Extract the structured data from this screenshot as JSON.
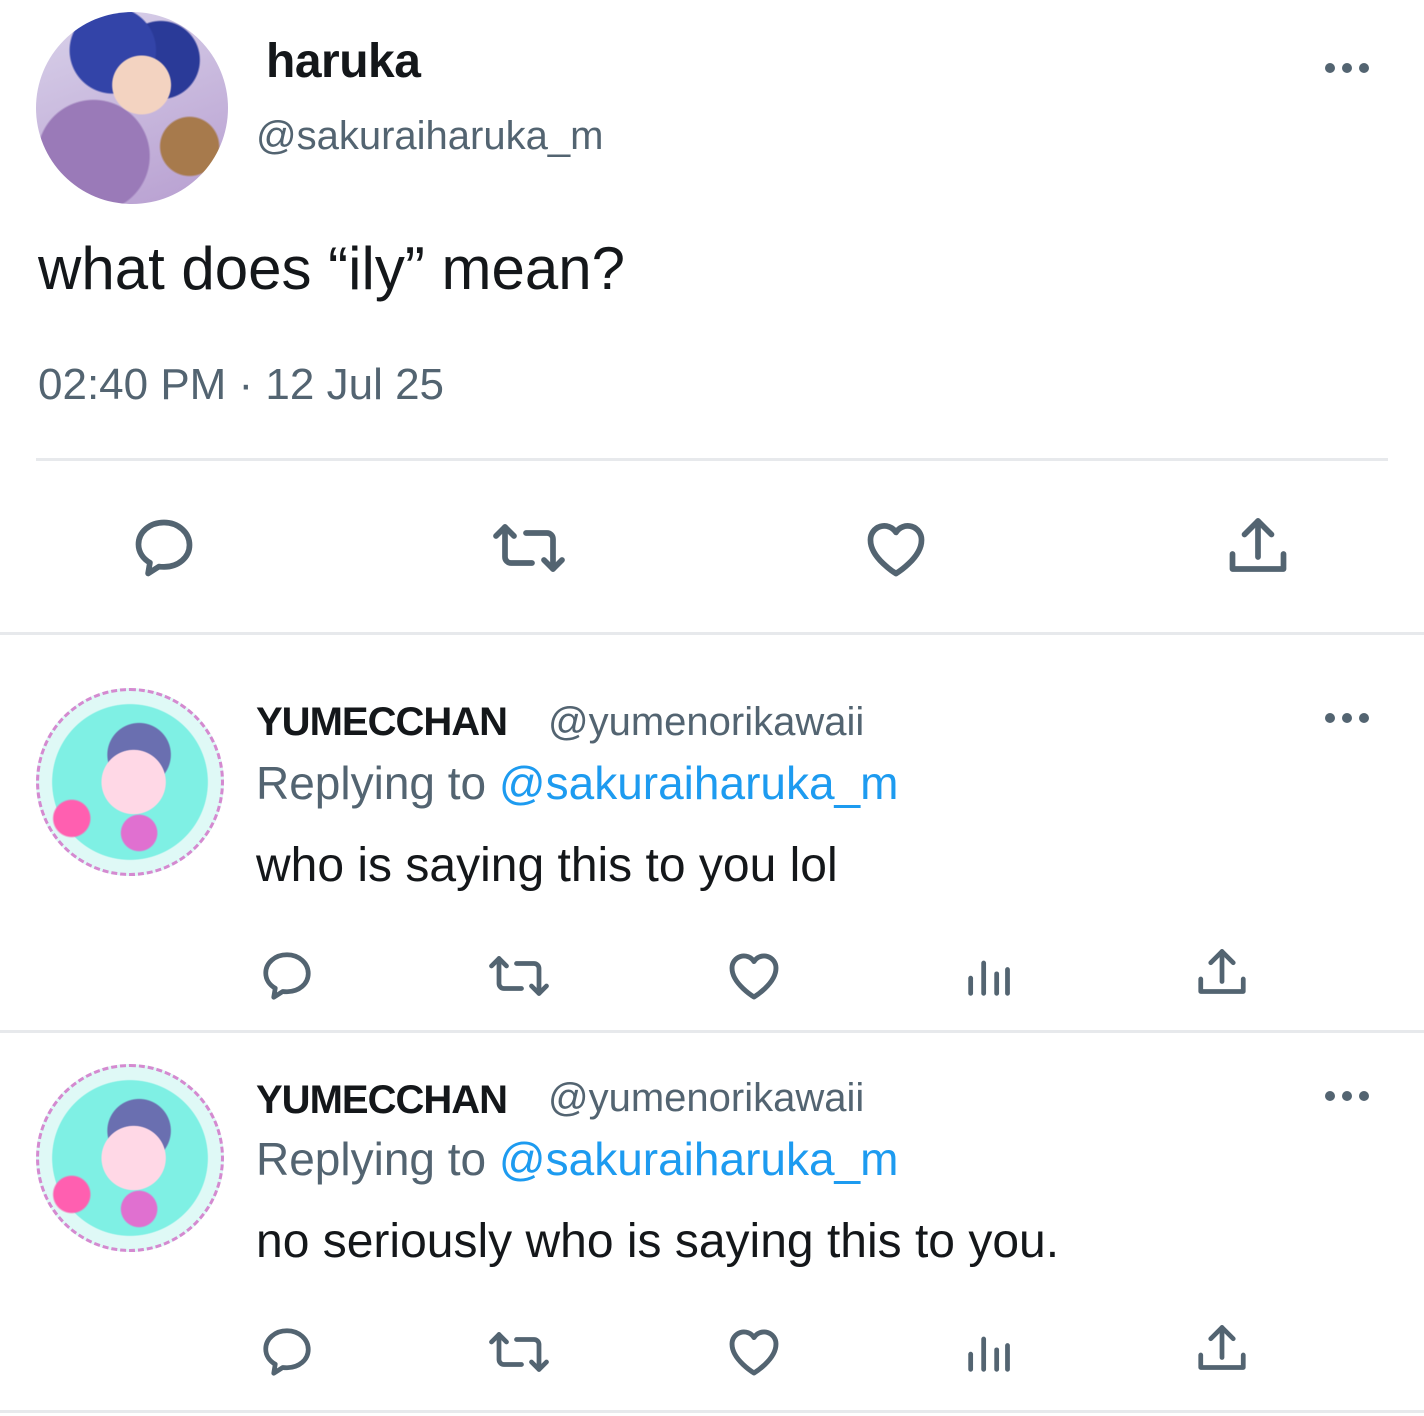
{
  "main_tweet": {
    "display_name": "haruka",
    "handle": "@sakuraiharuka_m",
    "text": "what does “ily” mean?",
    "timestamp": "02:40 PM · 12 Jul 25"
  },
  "replies": [
    {
      "display_name": "YUMECCHAN",
      "handle": "@yumenorikawaii",
      "replying_prefix": "Replying to ",
      "replying_to": "@sakuraiharuka_m",
      "text": "who is saying this to you lol"
    },
    {
      "display_name": "YUMECCHAN",
      "handle": "@yumenorikawaii",
      "replying_prefix": "Replying to ",
      "replying_to": "@sakuraiharuka_m",
      "text": "no seriously who is saying this to you."
    }
  ],
  "icons": {
    "more": "more-options-icon",
    "reply": "reply-icon",
    "retweet": "retweet-icon",
    "like": "heart-icon",
    "views": "views-icon",
    "share": "share-icon"
  },
  "colors": {
    "text": "#14171a",
    "secondary": "#536471",
    "mention": "#1d9bf0",
    "divider": "#e7e9ec"
  }
}
